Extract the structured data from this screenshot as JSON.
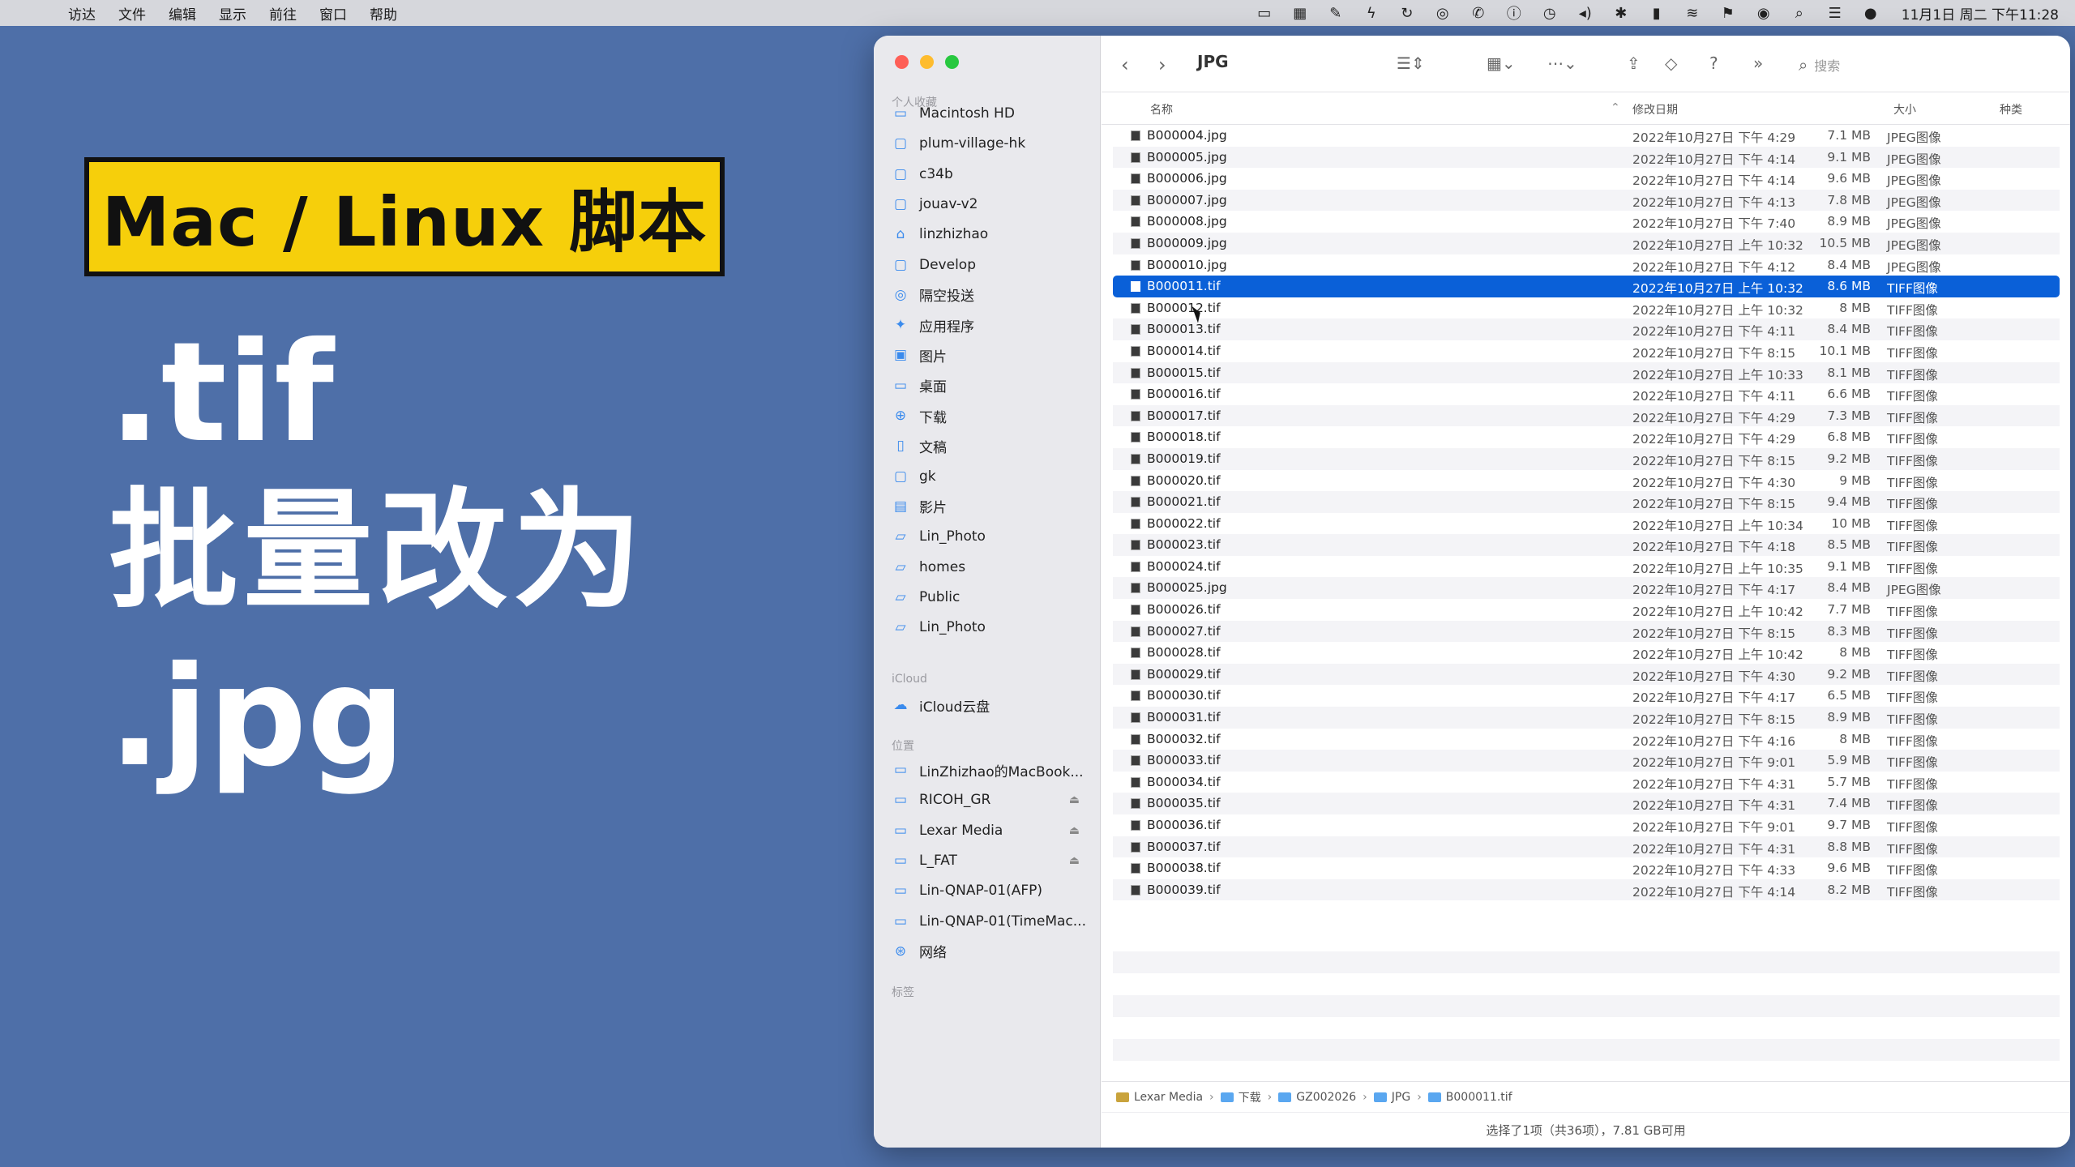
{
  "menubar": {
    "app_menus": [
      "访达",
      "文件",
      "编辑",
      "显示",
      "前往",
      "窗口",
      "帮助"
    ],
    "clock": "11月1日 周二 下午11:28"
  },
  "promo": {
    "badge": "Mac / Linux 脚本",
    "line1": ".tif",
    "line2": "批量改为",
    "line3": ".jpg"
  },
  "sidebar": {
    "favorites_label": "个人收藏",
    "favorites": [
      {
        "label": "Macintosh HD",
        "icon": "disk-icon"
      },
      {
        "label": "plum-village-hk",
        "icon": "folder-icon"
      },
      {
        "label": "c34b",
        "icon": "folder-icon"
      },
      {
        "label": "jouav-v2",
        "icon": "folder-icon"
      },
      {
        "label": "linzhizhao",
        "icon": "home-icon"
      },
      {
        "label": "Develop",
        "icon": "folder-icon"
      },
      {
        "label": "隔空投送",
        "icon": "airdrop-icon"
      },
      {
        "label": "应用程序",
        "icon": "apps-icon"
      },
      {
        "label": "图片",
        "icon": "photos-icon"
      },
      {
        "label": "桌面",
        "icon": "desktop-icon"
      },
      {
        "label": "下载",
        "icon": "download-icon"
      },
      {
        "label": "文稿",
        "icon": "document-icon"
      },
      {
        "label": "gk",
        "icon": "folder-icon"
      },
      {
        "label": "影片",
        "icon": "movies-icon"
      },
      {
        "label": "Lin_Photo",
        "icon": "network-disk-icon"
      },
      {
        "label": "homes",
        "icon": "network-disk-icon"
      },
      {
        "label": "Public",
        "icon": "network-disk-icon"
      },
      {
        "label": "Lin_Photo",
        "icon": "network-disk-icon"
      }
    ],
    "icloud_label": "iCloud",
    "icloud_items": [
      {
        "label": "iCloud云盘",
        "icon": "cloud-icon"
      }
    ],
    "locations_label": "位置",
    "locations": [
      {
        "label": "LinZhizhao的MacBook...",
        "icon": "laptop-icon"
      },
      {
        "label": "RICOH_GR",
        "icon": "drive-icon",
        "eject": true
      },
      {
        "label": "Lexar Media",
        "icon": "drive-icon",
        "eject": true
      },
      {
        "label": "L_FAT",
        "icon": "drive-icon",
        "eject": true
      },
      {
        "label": "Lin-QNAP-01(AFP)",
        "icon": "server-icon"
      },
      {
        "label": "Lin-QNAP-01(TimeMac...",
        "icon": "server-icon"
      },
      {
        "label": "网络",
        "icon": "globe-icon"
      }
    ],
    "tags_label": "标签"
  },
  "toolbar": {
    "title": "JPG",
    "search_placeholder": "搜索"
  },
  "columns": {
    "name": "名称",
    "date": "修改日期",
    "size": "大小",
    "kind": "种类"
  },
  "files": [
    {
      "name": "B000004.jpg",
      "date": "2022年10月27日 下午 4:29",
      "size": "7.1 MB",
      "kind": "JPEG图像"
    },
    {
      "name": "B000005.jpg",
      "date": "2022年10月27日 下午 4:14",
      "size": "9.1 MB",
      "kind": "JPEG图像"
    },
    {
      "name": "B000006.jpg",
      "date": "2022年10月27日 下午 4:14",
      "size": "9.6 MB",
      "kind": "JPEG图像"
    },
    {
      "name": "B000007.jpg",
      "date": "2022年10月27日 下午 4:13",
      "size": "7.8 MB",
      "kind": "JPEG图像"
    },
    {
      "name": "B000008.jpg",
      "date": "2022年10月27日 下午 7:40",
      "size": "8.9 MB",
      "kind": "JPEG图像"
    },
    {
      "name": "B000009.jpg",
      "date": "2022年10月27日 上午 10:32",
      "size": "10.5 MB",
      "kind": "JPEG图像"
    },
    {
      "name": "B000010.jpg",
      "date": "2022年10月27日 下午 4:12",
      "size": "8.4 MB",
      "kind": "JPEG图像"
    },
    {
      "name": "B000011.tif",
      "date": "2022年10月27日 上午 10:32",
      "size": "8.6 MB",
      "kind": "TIFF图像",
      "selected": true
    },
    {
      "name": "B000012.tif",
      "date": "2022年10月27日 上午 10:32",
      "size": "8 MB",
      "kind": "TIFF图像"
    },
    {
      "name": "B000013.tif",
      "date": "2022年10月27日 下午 4:11",
      "size": "8.4 MB",
      "kind": "TIFF图像"
    },
    {
      "name": "B000014.tif",
      "date": "2022年10月27日 下午 8:15",
      "size": "10.1 MB",
      "kind": "TIFF图像"
    },
    {
      "name": "B000015.tif",
      "date": "2022年10月27日 上午 10:33",
      "size": "8.1 MB",
      "kind": "TIFF图像"
    },
    {
      "name": "B000016.tif",
      "date": "2022年10月27日 下午 4:11",
      "size": "6.6 MB",
      "kind": "TIFF图像"
    },
    {
      "name": "B000017.tif",
      "date": "2022年10月27日 下午 4:29",
      "size": "7.3 MB",
      "kind": "TIFF图像"
    },
    {
      "name": "B000018.tif",
      "date": "2022年10月27日 下午 4:29",
      "size": "6.8 MB",
      "kind": "TIFF图像"
    },
    {
      "name": "B000019.tif",
      "date": "2022年10月27日 下午 8:15",
      "size": "9.2 MB",
      "kind": "TIFF图像"
    },
    {
      "name": "B000020.tif",
      "date": "2022年10月27日 下午 4:30",
      "size": "9 MB",
      "kind": "TIFF图像"
    },
    {
      "name": "B000021.tif",
      "date": "2022年10月27日 下午 8:15",
      "size": "9.4 MB",
      "kind": "TIFF图像"
    },
    {
      "name": "B000022.tif",
      "date": "2022年10月27日 上午 10:34",
      "size": "10 MB",
      "kind": "TIFF图像"
    },
    {
      "name": "B000023.tif",
      "date": "2022年10月27日 下午 4:18",
      "size": "8.5 MB",
      "kind": "TIFF图像"
    },
    {
      "name": "B000024.tif",
      "date": "2022年10月27日 上午 10:35",
      "size": "9.1 MB",
      "kind": "TIFF图像"
    },
    {
      "name": "B000025.jpg",
      "date": "2022年10月27日 下午 4:17",
      "size": "8.4 MB",
      "kind": "JPEG图像"
    },
    {
      "name": "B000026.tif",
      "date": "2022年10月27日 上午 10:42",
      "size": "7.7 MB",
      "kind": "TIFF图像"
    },
    {
      "name": "B000027.tif",
      "date": "2022年10月27日 下午 8:15",
      "size": "8.3 MB",
      "kind": "TIFF图像"
    },
    {
      "name": "B000028.tif",
      "date": "2022年10月27日 上午 10:42",
      "size": "8 MB",
      "kind": "TIFF图像"
    },
    {
      "name": "B000029.tif",
      "date": "2022年10月27日 下午 4:30",
      "size": "9.2 MB",
      "kind": "TIFF图像"
    },
    {
      "name": "B000030.tif",
      "date": "2022年10月27日 下午 4:17",
      "size": "6.5 MB",
      "kind": "TIFF图像"
    },
    {
      "name": "B000031.tif",
      "date": "2022年10月27日 下午 8:15",
      "size": "8.9 MB",
      "kind": "TIFF图像"
    },
    {
      "name": "B000032.tif",
      "date": "2022年10月27日 下午 4:16",
      "size": "8 MB",
      "kind": "TIFF图像"
    },
    {
      "name": "B000033.tif",
      "date": "2022年10月27日 下午 9:01",
      "size": "5.9 MB",
      "kind": "TIFF图像"
    },
    {
      "name": "B000034.tif",
      "date": "2022年10月27日 下午 4:31",
      "size": "5.7 MB",
      "kind": "TIFF图像"
    },
    {
      "name": "B000035.tif",
      "date": "2022年10月27日 下午 4:31",
      "size": "7.4 MB",
      "kind": "TIFF图像"
    },
    {
      "name": "B000036.tif",
      "date": "2022年10月27日 下午 9:01",
      "size": "9.7 MB",
      "kind": "TIFF图像"
    },
    {
      "name": "B000037.tif",
      "date": "2022年10月27日 下午 4:31",
      "size": "8.8 MB",
      "kind": "TIFF图像"
    },
    {
      "name": "B000038.tif",
      "date": "2022年10月27日 下午 4:33",
      "size": "9.6 MB",
      "kind": "TIFF图像"
    },
    {
      "name": "B000039.tif",
      "date": "2022年10月27日 下午 4:14",
      "size": "8.2 MB",
      "kind": "TIFF图像"
    }
  ],
  "pathbar": [
    "Lexar Media",
    "下载",
    "GZ002026",
    "JPG",
    "B000011.tif"
  ],
  "status": "选择了1项（共36项），7.81 GB可用",
  "colors": {
    "desktop": "#4e6fa8",
    "badge": "#f6cf0b",
    "selection": "#0a60d8"
  }
}
